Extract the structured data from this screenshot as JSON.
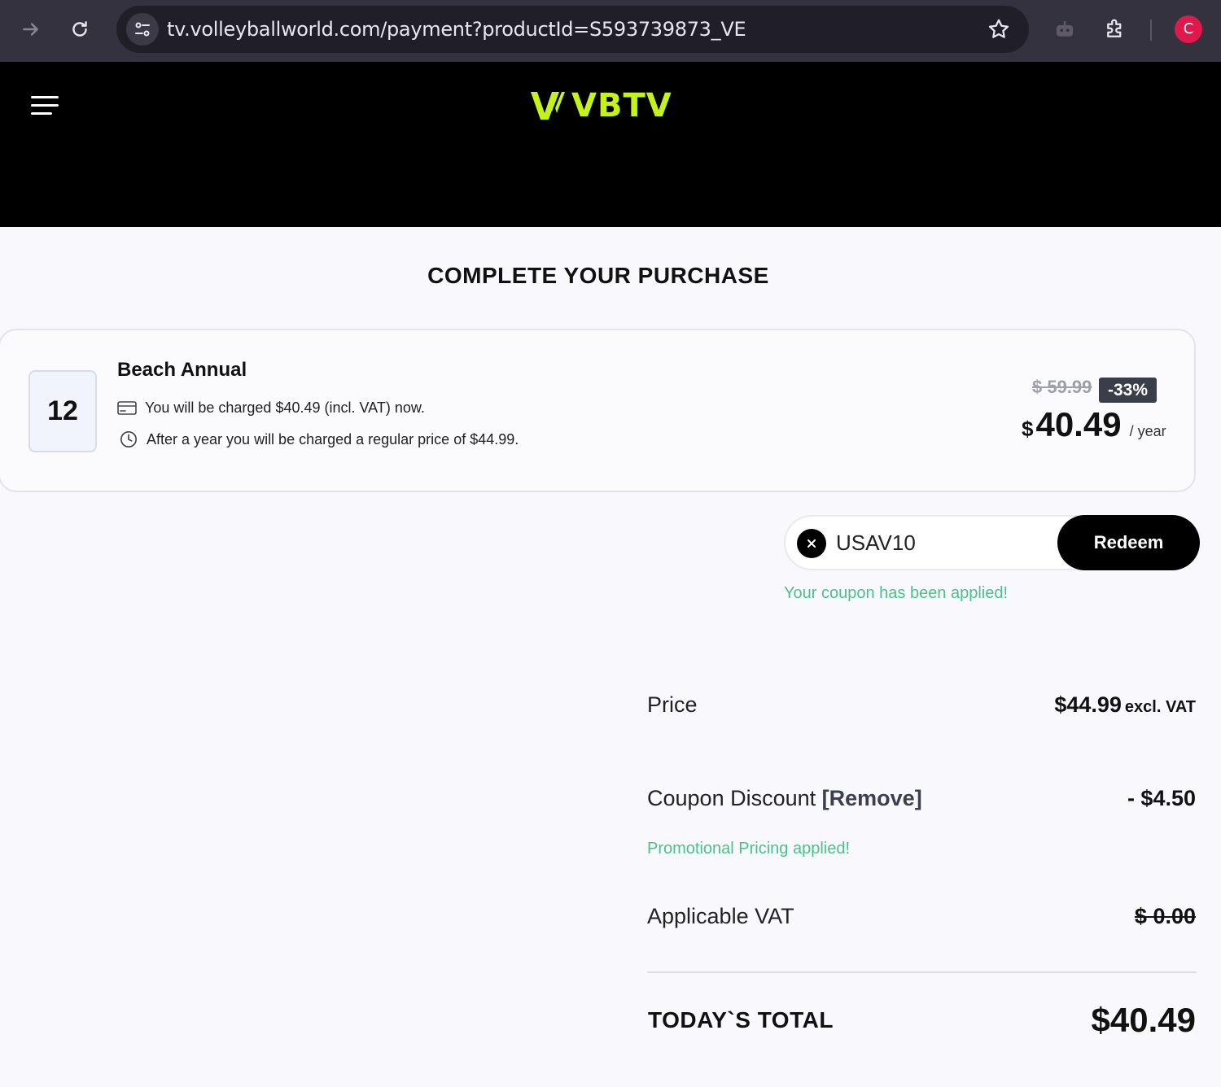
{
  "browser": {
    "url": "tv.volleyballworld.com/payment?productId=S593739873_VE",
    "profile_initial": "C"
  },
  "site": {
    "logo_text": "VBTV",
    "brand_color": "#c6f21c"
  },
  "page": {
    "title": "COMPLETE YOUR PURCHASE"
  },
  "product": {
    "months": "12",
    "name": "Beach Annual",
    "charge_note": "You will be charged $40.49 (incl. VAT) now.",
    "renewal_note": "After a year you will be charged a regular price of $44.99.",
    "old_price": "$ 59.99",
    "discount": "-33%",
    "currency": "$",
    "price": "40.49",
    "period": "/ year"
  },
  "coupon": {
    "code": "USAV10",
    "redeem_label": "Redeem",
    "message": "Your coupon has been applied!",
    "success_color": "#4cbf8a"
  },
  "summary": {
    "price_label": "Price",
    "price_value": "$44.99",
    "price_vat_note": "excl. VAT",
    "discount_label": "Coupon Discount",
    "remove_label": "[Remove]",
    "discount_value": "- $4.50",
    "promo_message": "Promotional Pricing applied!",
    "vat_label": "Applicable VAT",
    "vat_value": "$ 0.00",
    "total_label": "TODAY`S TOTAL",
    "total_value": "$40.49"
  }
}
